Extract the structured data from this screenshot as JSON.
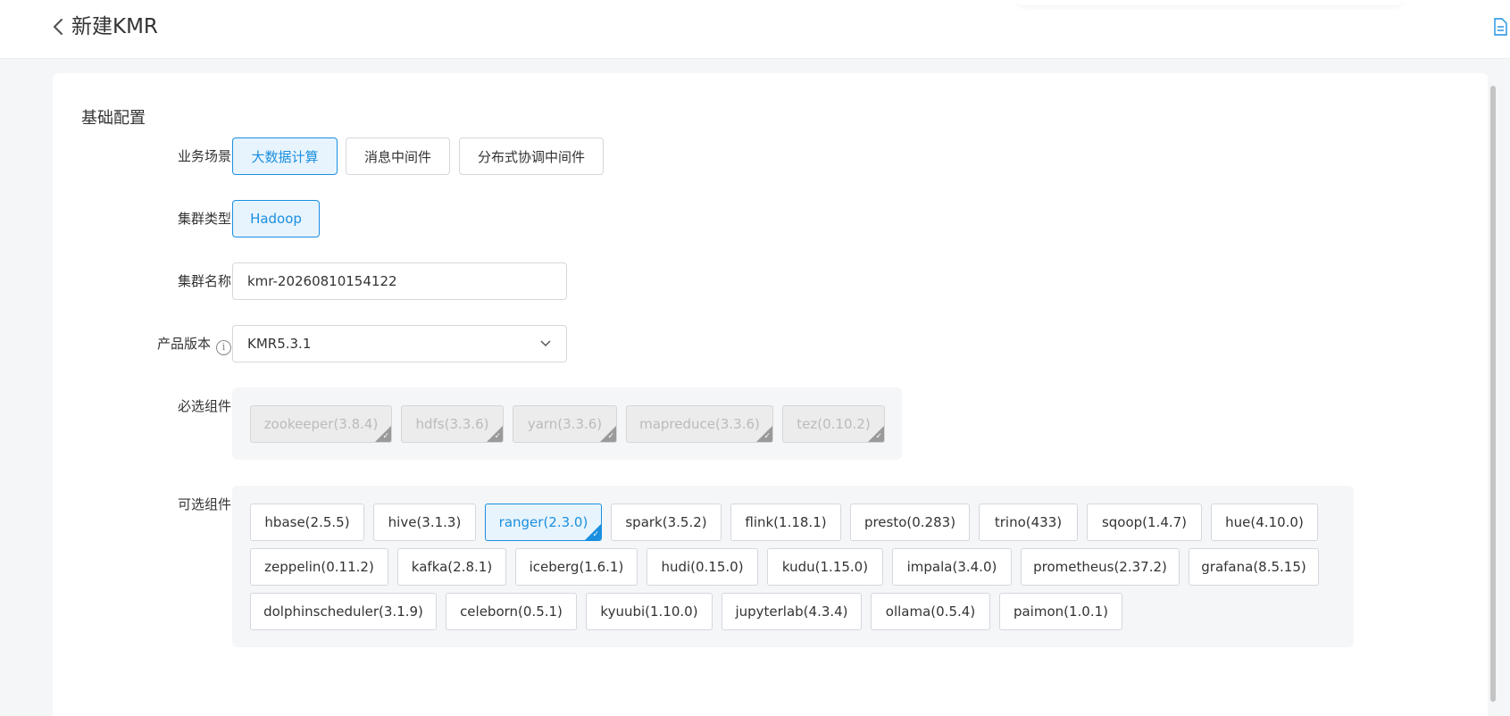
{
  "header": {
    "title": "新建KMR"
  },
  "section": {
    "title": "基础配置"
  },
  "scenario": {
    "label": "业务场景",
    "options": [
      {
        "label": "大数据计算",
        "selected": true
      },
      {
        "label": "消息中间件",
        "selected": false
      },
      {
        "label": "分布式协调中间件",
        "selected": false
      }
    ]
  },
  "cluster_type": {
    "label": "集群类型",
    "options": [
      {
        "label": "Hadoop",
        "selected": true
      }
    ]
  },
  "cluster_name": {
    "label": "集群名称",
    "value": "kmr-20260810154122"
  },
  "product_version": {
    "label": "产品版本",
    "value": "KMR5.3.1"
  },
  "required_components": {
    "label": "必选组件",
    "items": [
      "zookeeper(3.8.4)",
      "hdfs(3.3.6)",
      "yarn(3.3.6)",
      "mapreduce(3.3.6)",
      "tez(0.10.2)"
    ]
  },
  "optional_components": {
    "label": "可选组件",
    "items": [
      "hbase(2.5.5)",
      "hive(3.1.3)",
      "ranger(2.3.0)",
      "spark(3.5.2)",
      "flink(1.18.1)",
      "presto(0.283)",
      "trino(433)",
      "sqoop(1.4.7)",
      "hue(4.10.0)",
      "zeppelin(0.11.2)",
      "kafka(2.8.1)",
      "iceberg(1.6.1)",
      "hudi(0.15.0)",
      "kudu(1.15.0)",
      "impala(3.4.0)",
      "prometheus(2.37.2)",
      "grafana(8.5.15)",
      "dolphinscheduler(3.1.9)",
      "celeborn(0.5.1)",
      "kyuubi(1.10.0)",
      "jupyterlab(4.3.4)",
      "ollama(0.5.4)",
      "paimon(1.0.1)"
    ],
    "selected": [
      "ranger(2.3.0)"
    ]
  }
}
